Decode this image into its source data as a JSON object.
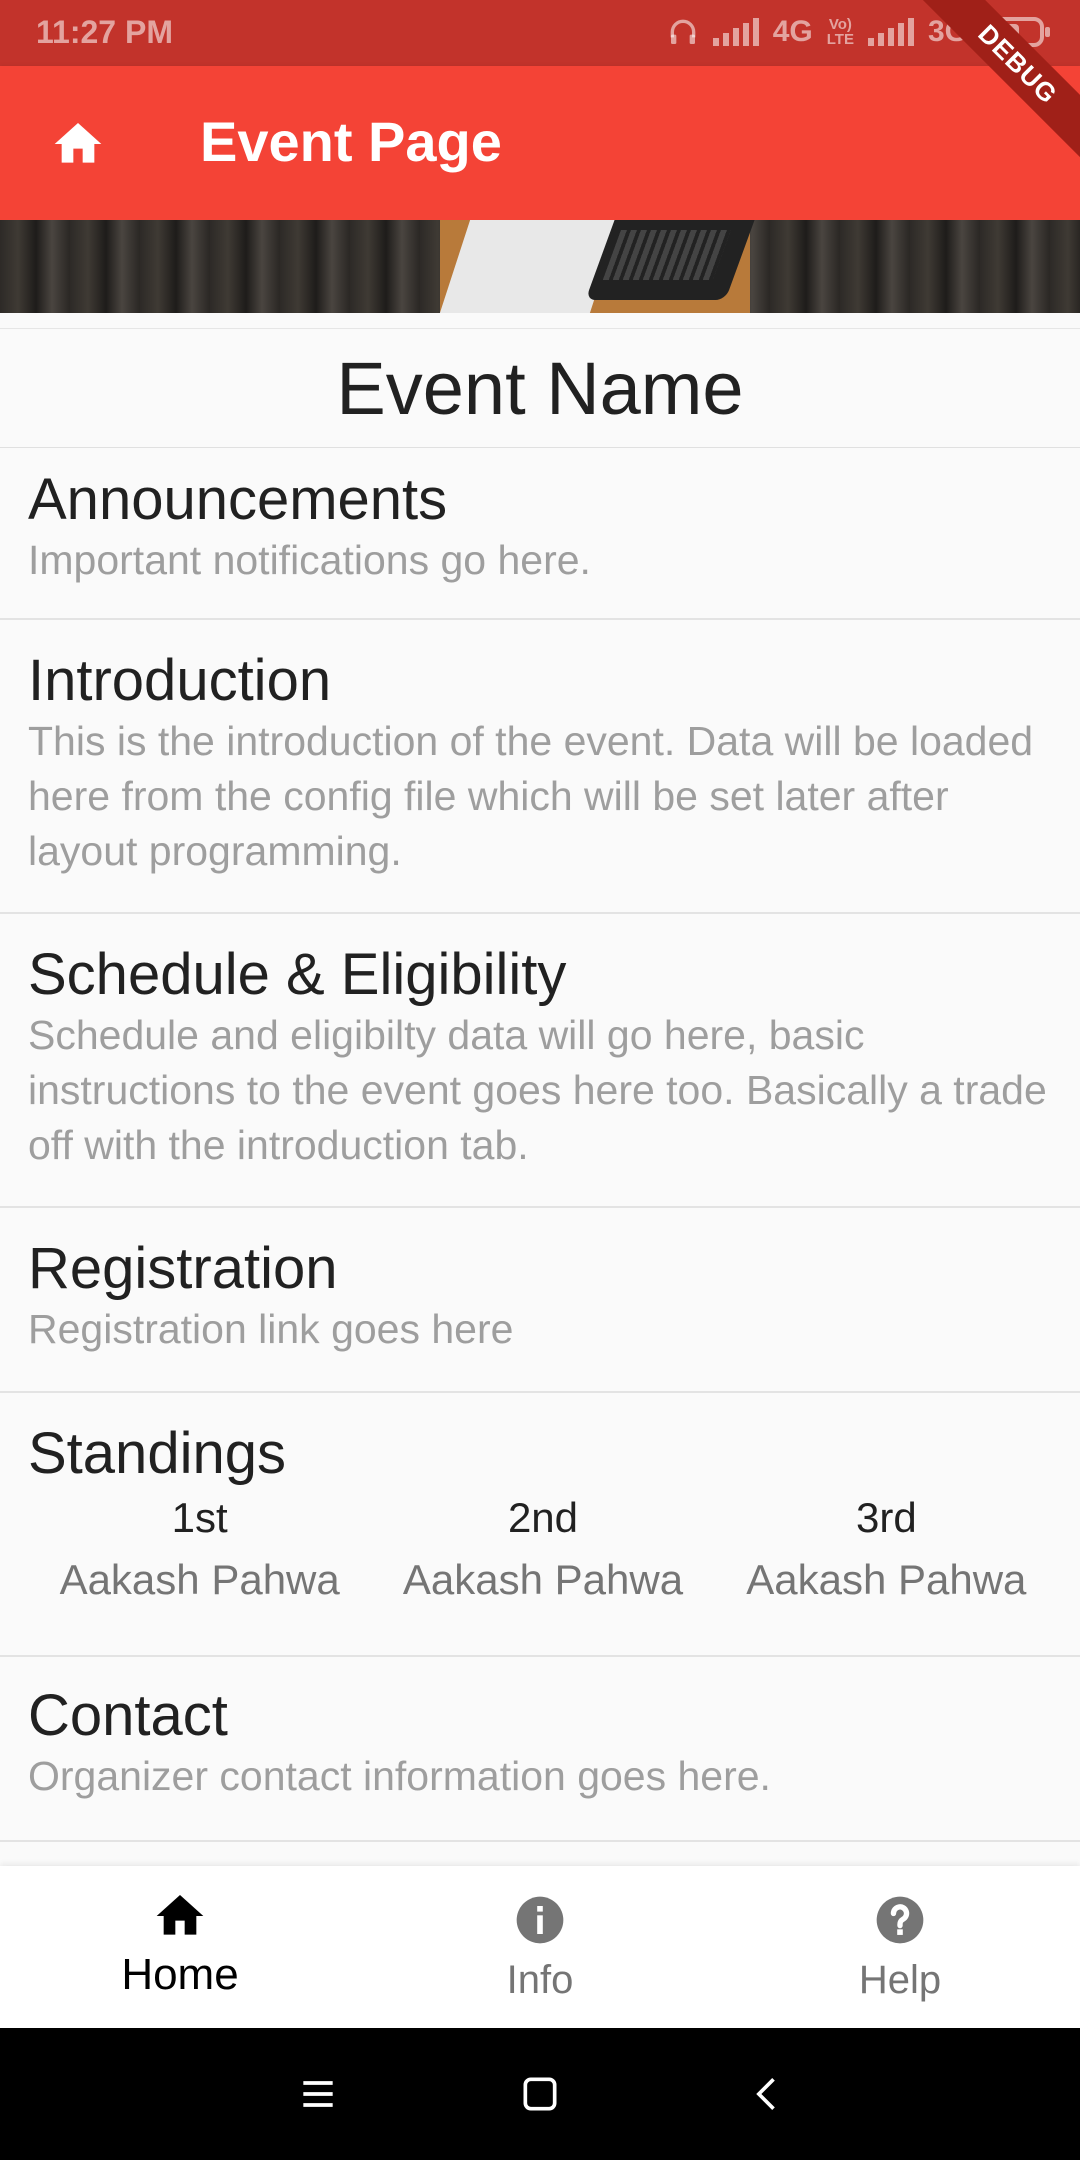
{
  "status_bar": {
    "time": "11:27 PM",
    "net1": "4G",
    "lte_top": "Vo)",
    "lte_bottom": "LTE",
    "net2": "3G"
  },
  "debug_banner": "DEBUG",
  "app_bar": {
    "title": "Event Page",
    "leading_icon": "home-icon"
  },
  "event": {
    "name": "Event Name"
  },
  "sections": [
    {
      "title": "Announcements",
      "body": "Important notifications go here."
    },
    {
      "title": "Introduction",
      "body": "This is the introduction of the event. Data will be loaded here from the config file which will be set later after layout programming."
    },
    {
      "title": "Schedule & Eligibility",
      "body": "Schedule and eligibilty data will go here, basic instructions to the event goes here too. Basically a trade off with the introduction tab."
    },
    {
      "title": "Registration",
      "body": "Registration link goes here"
    }
  ],
  "standings": {
    "title": "Standings",
    "places": [
      {
        "place": "1st",
        "name": "Aakash Pahwa"
      },
      {
        "place": "2nd",
        "name": "Aakash Pahwa"
      },
      {
        "place": "3rd",
        "name": "Aakash Pahwa"
      }
    ]
  },
  "contact": {
    "title": "Contact",
    "body": "Organizer contact information goes here."
  },
  "bottom_nav": [
    {
      "label": "Home",
      "icon": "home-icon",
      "active": true
    },
    {
      "label": "Info",
      "icon": "info-icon",
      "active": false
    },
    {
      "label": "Help",
      "icon": "help-icon",
      "active": false
    }
  ],
  "colors": {
    "primary": "#f44336",
    "status_bar": "#c2332b",
    "title_text": "#212121",
    "body_text": "#9e9e9e"
  }
}
